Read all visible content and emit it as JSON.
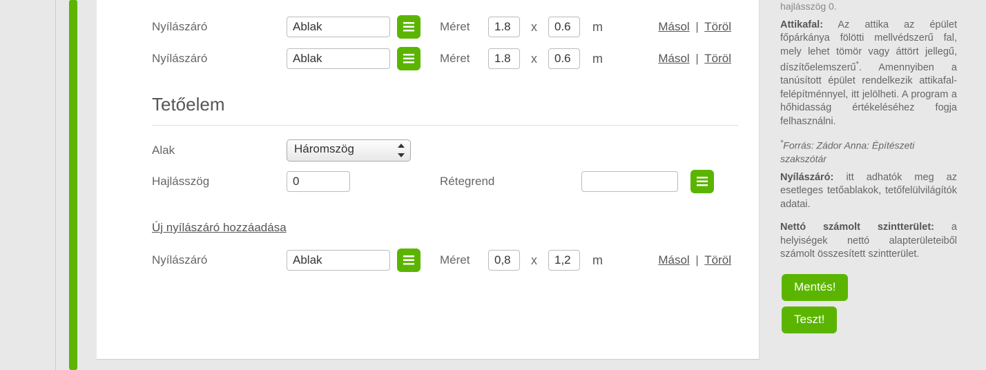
{
  "labels": {
    "nyilaszaro": "Nyílászáró",
    "meret": "Méret",
    "masol": "Másol",
    "torol": "Töröl",
    "action_sep": "|",
    "x": "x",
    "m": "m"
  },
  "openings_top": [
    {
      "type": "Ablak",
      "w": "1.8",
      "h": "0.6"
    },
    {
      "type": "Ablak",
      "w": "1.8",
      "h": "0.6"
    }
  ],
  "section": {
    "title": "Tetőelem",
    "alak_label": "Alak",
    "alak_value": "Háromszög",
    "hajlasszog_label": "Hajlásszög",
    "hajlasszog_value": "0",
    "retegrend_label": "Rétegrend",
    "retegrend_value": "",
    "add_link": "Új nyílászáró hozzáadása"
  },
  "openings_section": [
    {
      "type": "Ablak",
      "w": "0,8",
      "h": "1,2"
    }
  ],
  "sidebar": {
    "cut": "hajlásszög 0.",
    "attikafal_title": "Attikafal:",
    "attikafal_text": "Az attika az épület főpárkánya fölötti mellvédszerű fal, mely lehet tömör vagy áttört jellegű, díszítőelemszerű",
    "attikafal_text2": ". Amennyiben a tanúsított épület rendelkezik attikafal-felépítménnyel, itt jelölheti. A program a hőhidasság értékeléséhez fogja felhasználni.",
    "source_mark": "*",
    "source": "Forrás: Zádor Anna: Építészeti szakszótár",
    "nyilaszaro_title": "Nyílászáró:",
    "nyilaszaro_text": "itt adhatók meg az esetleges tetőablakok, tetőfelülvilágítók adatai.",
    "netto_title": "Nettó számolt szintterület:",
    "netto_text": "a helyiségek nettó alapterületeiből számolt összesített szintterület.",
    "save_btn": "Mentés!",
    "test_btn": "Teszt!"
  }
}
